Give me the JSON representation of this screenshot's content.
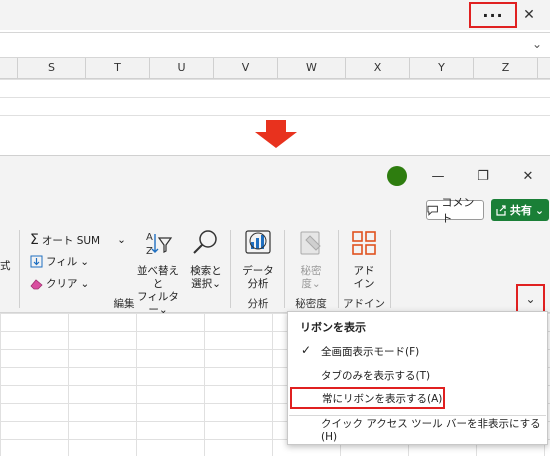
{
  "top": {
    "more_label": "···",
    "close_label": "✕",
    "formula_chevron": "⌄",
    "columns": [
      "S",
      "T",
      "U",
      "V",
      "W",
      "X",
      "Y",
      "Z"
    ]
  },
  "bottom": {
    "titlebar": {
      "minimize": "—",
      "restore": "❐",
      "close": "✕"
    },
    "comment_label": "コメント",
    "share_label": "共有",
    "ribbon": {
      "autosum": "オート SUM",
      "fill": "フィル",
      "clear": "クリア",
      "sort_filter_1": "並べ替えと",
      "sort_filter_2": "フィルター",
      "find_select_1": "検索と",
      "find_select_2": "選択",
      "data_analysis_1": "データ",
      "data_analysis_2": "分析",
      "sensitivity_1": "秘密",
      "sensitivity_2": "度",
      "addins_1": "アド",
      "addins_2": "イン",
      "group_edit": "編集",
      "group_analysis": "分析",
      "group_sensitivity": "秘密度",
      "group_addins": "アドイン",
      "left_cut_1": "式",
      "dropdown_arrow": "⌄",
      "collapse_chevron": "⌄"
    },
    "menu": {
      "header": "リボンを表示",
      "items": [
        {
          "label": "全画面表示モード(F)",
          "checked": true
        },
        {
          "label": "タブのみを表示する(T)",
          "checked": false
        },
        {
          "label": "常にリボンを表示する(A)",
          "checked": false
        },
        {
          "label": "クイック アクセス ツール バーを非表示にする (H)",
          "checked": false
        }
      ],
      "check_glyph": "✓"
    }
  },
  "colors": {
    "accent_red": "#e02020",
    "share_green": "#1a7f37",
    "status_dot": "#2e7d0f",
    "arrow_red": "#e8321e"
  }
}
